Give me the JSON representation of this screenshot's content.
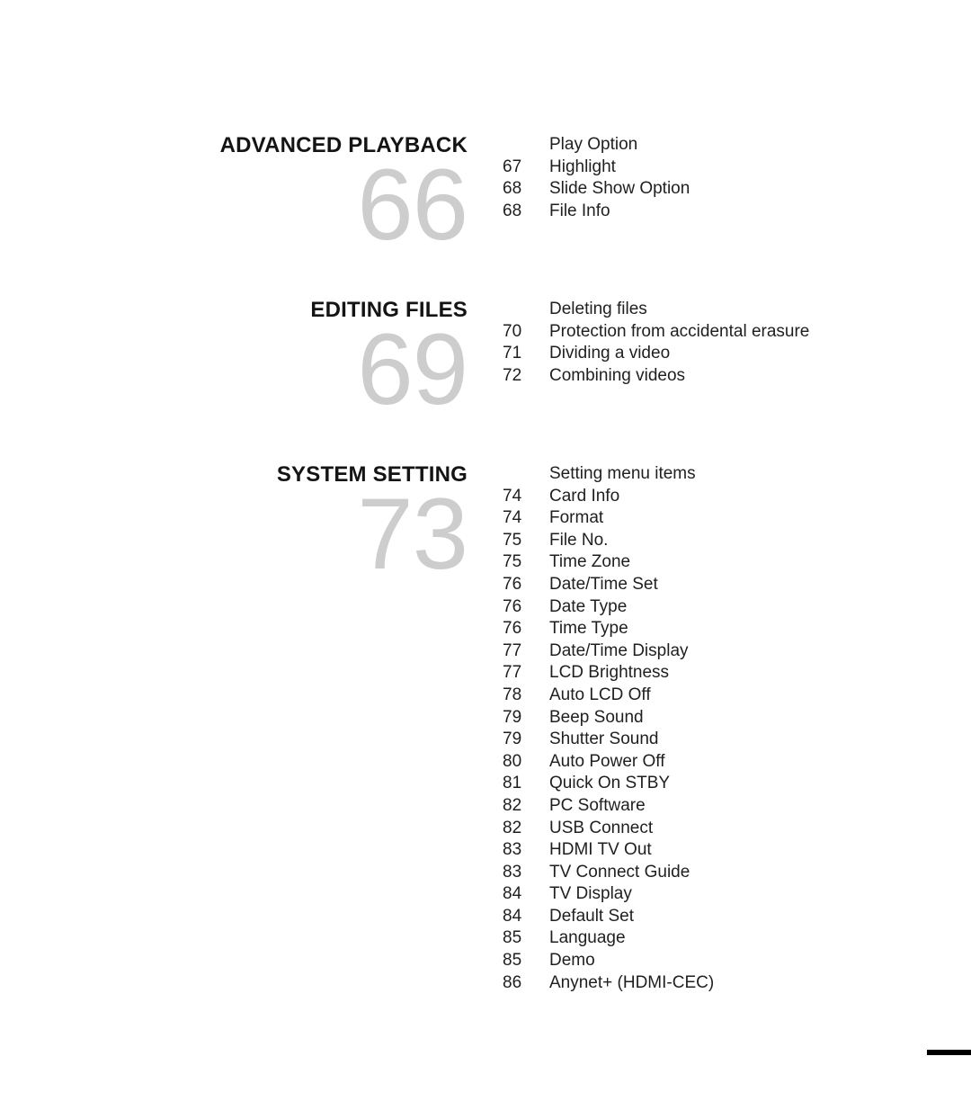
{
  "document": {
    "type": "table-of-contents",
    "background_color": "#ffffff",
    "text_color": "#1f1f1f",
    "section_number_color": "#cdcdcd"
  },
  "sections": [
    {
      "title": "ADVANCED PLAYBACK",
      "number": "66",
      "entries": [
        {
          "page": "",
          "label": "Play Option"
        },
        {
          "page": "67",
          "label": "Highlight"
        },
        {
          "page": "68",
          "label": "Slide Show Option"
        },
        {
          "page": "68",
          "label": "File Info"
        }
      ]
    },
    {
      "title": "EDITING FILES",
      "number": "69",
      "entries": [
        {
          "page": "",
          "label": "Deleting files"
        },
        {
          "page": "70",
          "label": "Protection from accidental erasure"
        },
        {
          "page": "71",
          "label": "Dividing a video"
        },
        {
          "page": "72",
          "label": "Combining videos"
        }
      ]
    },
    {
      "title": "SYSTEM SETTING",
      "number": "73",
      "entries": [
        {
          "page": "",
          "label": "Setting menu items"
        },
        {
          "page": "74",
          "label": "Card Info"
        },
        {
          "page": "74",
          "label": "Format"
        },
        {
          "page": "75",
          "label": "File No."
        },
        {
          "page": "75",
          "label": "Time Zone"
        },
        {
          "page": "76",
          "label": "Date/Time Set"
        },
        {
          "page": "76",
          "label": "Date Type"
        },
        {
          "page": "76",
          "label": "Time Type"
        },
        {
          "page": "77",
          "label": "Date/Time Display"
        },
        {
          "page": "77",
          "label": "LCD Brightness"
        },
        {
          "page": "78",
          "label": "Auto LCD Off"
        },
        {
          "page": "79",
          "label": "Beep Sound"
        },
        {
          "page": "79",
          "label": "Shutter Sound"
        },
        {
          "page": "80",
          "label": "Auto Power Off"
        },
        {
          "page": "81",
          "label": "Quick On STBY"
        },
        {
          "page": "82",
          "label": "PC Software"
        },
        {
          "page": "82",
          "label": "USB Connect"
        },
        {
          "page": "83",
          "label": "HDMI TV Out"
        },
        {
          "page": "83",
          "label": "TV Connect Guide"
        },
        {
          "page": "84",
          "label": "TV Display"
        },
        {
          "page": "84",
          "label": "Default Set"
        },
        {
          "page": "85",
          "label": "Language"
        },
        {
          "page": "85",
          "label": "Demo"
        },
        {
          "page": "86",
          "label": "Anynet+ (HDMI-CEC)"
        }
      ]
    }
  ],
  "trim_mark": {
    "color": "#000000"
  }
}
